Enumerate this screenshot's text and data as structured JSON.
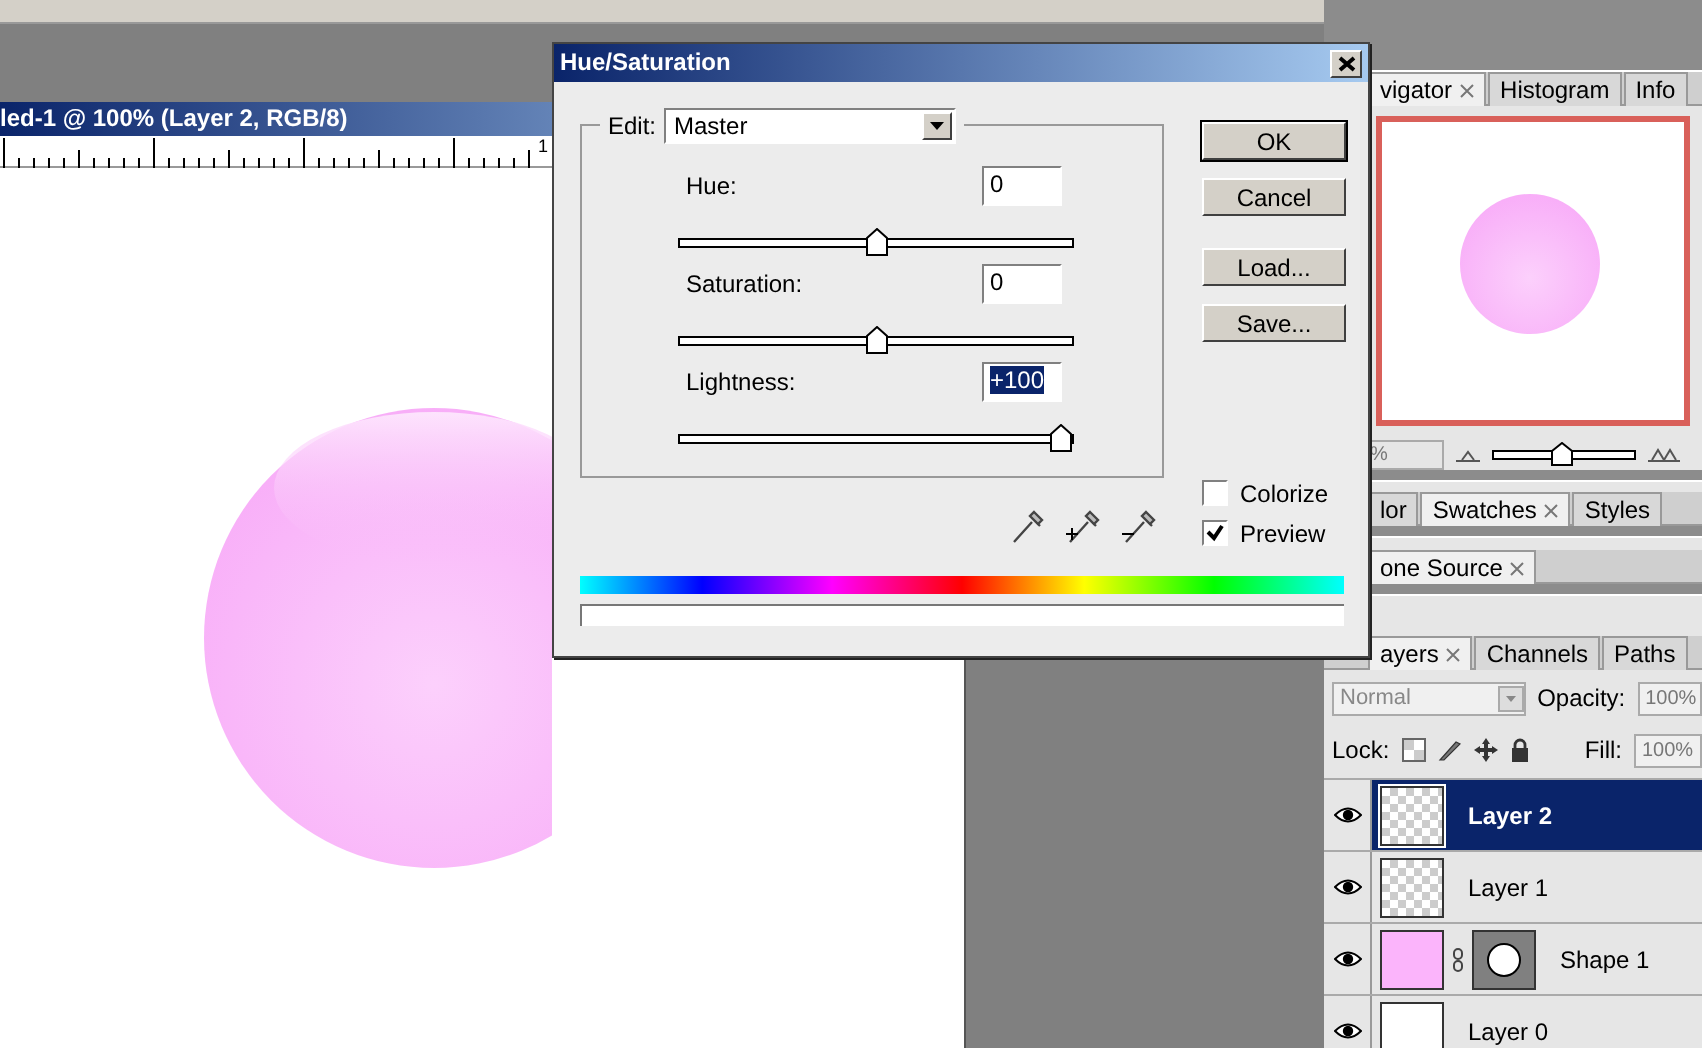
{
  "document": {
    "title": "led-1 @ 100% (Layer 2, RGB/8)",
    "ruler_label": "1"
  },
  "dialog": {
    "title": "Hue/Saturation",
    "edit_label": "Edit:",
    "edit_value": "Master",
    "sliders": [
      {
        "label": "Hue:",
        "value": "0",
        "level": 0.5,
        "selected": false
      },
      {
        "label": "Saturation:",
        "value": "0",
        "level": 0.5,
        "selected": false
      },
      {
        "label": "Lightness:",
        "value": "+100",
        "level": 1,
        "selected": true
      }
    ],
    "buttons": [
      {
        "label": "OK",
        "default": true
      },
      {
        "label": "Cancel",
        "default": false
      },
      {
        "label": "Load...",
        "default": false
      },
      {
        "label": "Save...",
        "default": false
      }
    ],
    "checkboxes": [
      {
        "label": "Colorize",
        "checked": false
      },
      {
        "label": "Preview",
        "checked": true
      }
    ]
  },
  "navigator_panel": {
    "tabs": [
      {
        "label": "vigator",
        "selected": true
      },
      {
        "label": "Histogram",
        "selected": false
      },
      {
        "label": "Info",
        "selected": false
      }
    ],
    "zoom": {
      "value": "%",
      "level": 0.48
    }
  },
  "color_panel": {
    "tabs": [
      {
        "label": "lor",
        "selected": false
      },
      {
        "label": "Swatches",
        "selected": true
      },
      {
        "label": "Styles",
        "selected": false
      }
    ]
  },
  "clone_panel": {
    "tabs": [
      {
        "label": "one Source",
        "selected": true
      }
    ]
  },
  "layers_panel": {
    "tabs": [
      {
        "label": "ayers",
        "selected": true
      },
      {
        "label": "Channels",
        "selected": false
      },
      {
        "label": "Paths",
        "selected": false
      }
    ],
    "blend_mode": {
      "value": "Normal",
      "disabled": true
    },
    "opacity_label": "Opacity:",
    "opacity": "100%",
    "lock_label": "Lock:",
    "fill_label": "Fill:",
    "fill": "100%",
    "layers": [
      {
        "name": "Layer 2",
        "kind": "transparent",
        "selected": true,
        "visible": true
      },
      {
        "name": "Layer 1",
        "kind": "transparent",
        "selected": false,
        "visible": true
      },
      {
        "name": "Shape 1",
        "kind": "shape",
        "selected": false,
        "visible": true
      },
      {
        "name": "Layer 0",
        "kind": "white",
        "selected": false,
        "visible": true
      }
    ]
  }
}
